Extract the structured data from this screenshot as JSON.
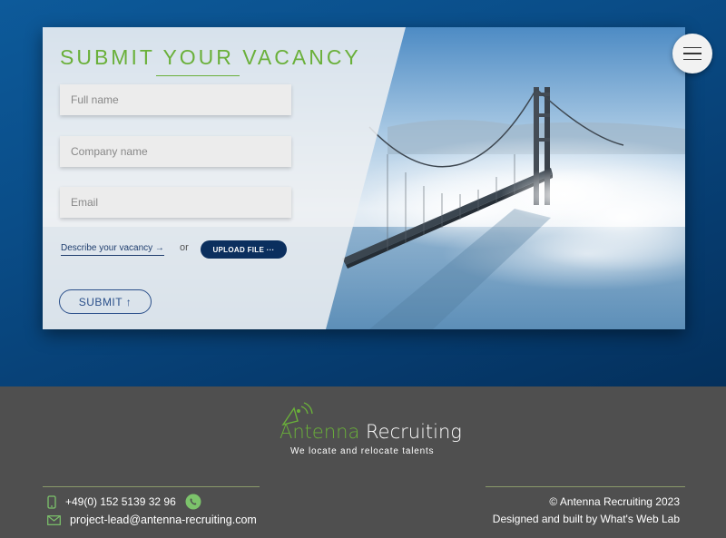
{
  "form": {
    "title": "SUBMIT YOUR VACANCY",
    "fields": {
      "full_name_placeholder": "Full name",
      "company_placeholder": "Company name",
      "email_placeholder": "Email"
    },
    "describe_link": "Describe your vacancy →",
    "or_text": "or",
    "upload_label": "UPLOAD FILE ···",
    "submit_label": "SUBMIT ↑"
  },
  "menu": {
    "icon": "hamburger-menu-icon"
  },
  "footer": {
    "logo": {
      "word1": "Antenna",
      "word2": "Recruiting",
      "tagline": "We locate and relocate talents"
    },
    "phone": "+49(0) 152 5139 32 96",
    "email": "project-lead@antenna-recruiting.com",
    "copyright": "© Antenna Recruiting 2023",
    "credits": "Designed and built by What's Web Lab"
  },
  "colors": {
    "accent_green": "#6ab03a",
    "navy": "#0b2f5e",
    "footer_bg": "#4f4f4f",
    "whatsapp_green": "#7cc36b"
  }
}
